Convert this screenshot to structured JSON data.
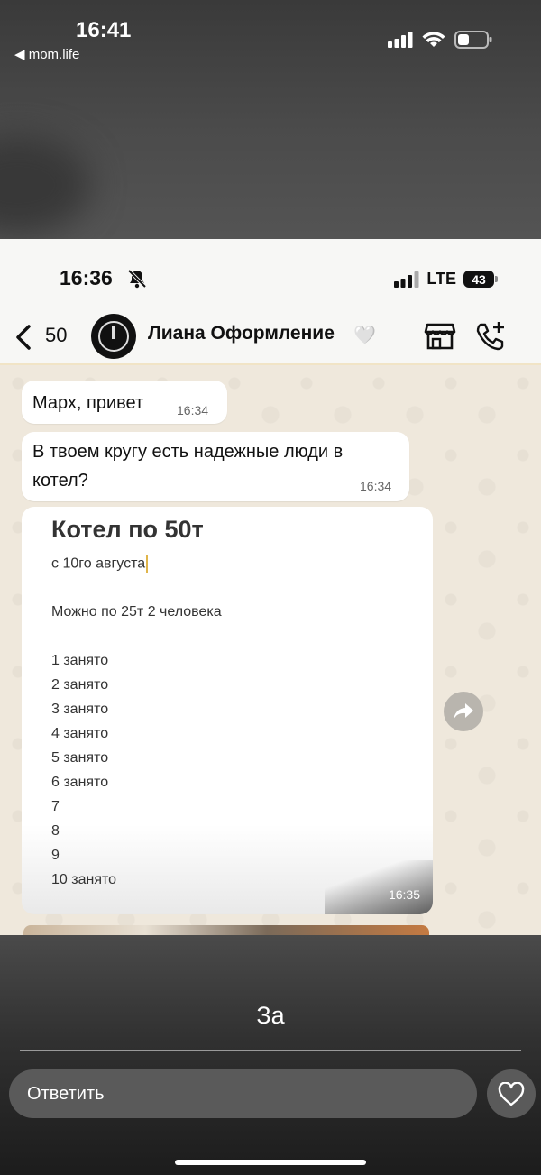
{
  "outer_status": {
    "time": "16:41",
    "back_app": "◀ mom.life"
  },
  "inner_status": {
    "time": "16:36",
    "network": "LTE",
    "battery": "43"
  },
  "chat_header": {
    "back_count": "50",
    "contact_name": "Лиана Оформление",
    "contact_emoji": "🤍"
  },
  "messages": [
    {
      "text": "Марх, привет",
      "time": "16:34"
    },
    {
      "text": "В твоем кругу есть надежные люди в котел?",
      "time": "16:34"
    }
  ],
  "image_message": {
    "title": "Котел по 50т",
    "date_line": "с 10го августа",
    "split_line": "Можно по 25т 2 человека",
    "slots": [
      "1 занято",
      "2 занято",
      "3 занято",
      "4 занято",
      "5 занято",
      "6 занято",
      "7",
      "8",
      "9",
      "10 занято"
    ],
    "time": "16:35"
  },
  "story": {
    "caption": "За",
    "reply_placeholder": "Ответить"
  }
}
